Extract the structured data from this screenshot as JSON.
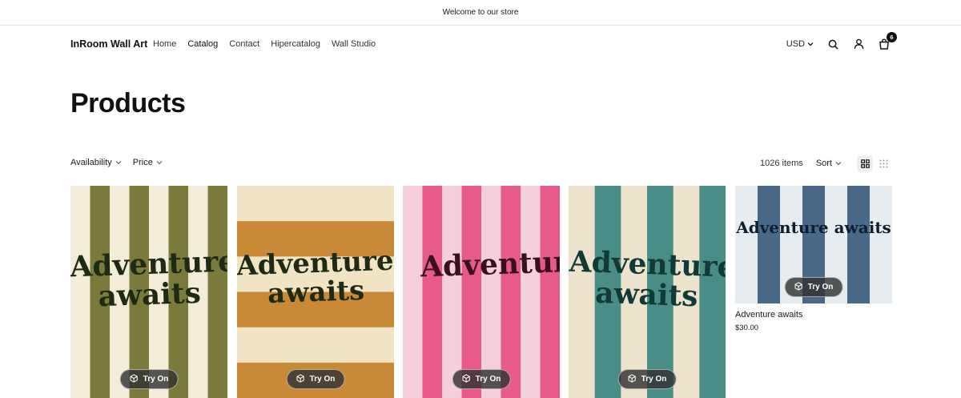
{
  "announcement": "Welcome to our store",
  "header": {
    "brand": "InRoom Wall Art",
    "nav": [
      "Home",
      "Catalog",
      "Contact",
      "Hipercatalog",
      "Wall Studio"
    ],
    "currency": "USD",
    "cart_count": "6",
    "icons": [
      "search-icon",
      "account-icon",
      "cart-icon"
    ]
  },
  "page_title": "Products",
  "filters": [
    "Availability",
    "Price"
  ],
  "toolbar": {
    "count": "1026 items",
    "sort_label": "Sort"
  },
  "products": [
    {
      "poster_text": "Adventure awaits",
      "try_on": "Try On",
      "colors": [
        "#f3ecd8",
        "#7a7a3a"
      ],
      "text_color": "#1f2a14"
    },
    {
      "poster_text": "Adventure awaits",
      "try_on": "Try On",
      "colors": [
        "#f0e4c4",
        "#c98a38"
      ],
      "text_color": "#1f2a14"
    },
    {
      "poster_text": "Adventure awaits",
      "try_on": "Try On",
      "colors": [
        "#f6cfdc",
        "#e85a88"
      ],
      "text_color": "#3a0f1e"
    },
    {
      "poster_text": "Adventure awaits",
      "try_on": "Try On",
      "colors": [
        "#ede2cc",
        "#4a8c86"
      ],
      "text_color": "#0f3a36"
    },
    {
      "poster_text": "Adventure awaits",
      "try_on": "Try On",
      "colors": [
        "#e6ecef",
        "#4a6888"
      ],
      "text_color": "#0f1e2e",
      "title": "Adventure awaits",
      "price": "$30.00"
    }
  ]
}
